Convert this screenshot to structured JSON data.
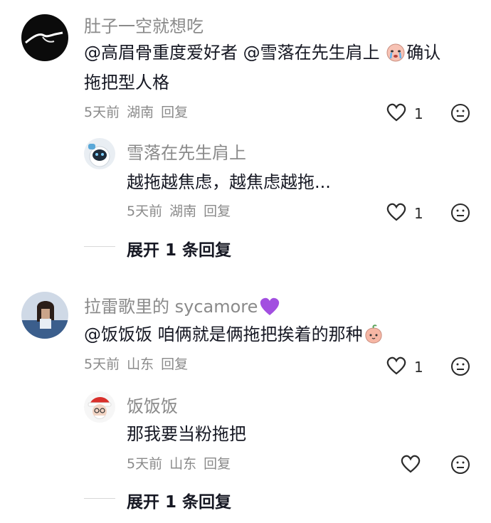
{
  "comments": [
    {
      "username": "肚子一空就想吃",
      "mentions": [
        "@高眉骨重度爱好者",
        "@雪落在先生肩上"
      ],
      "text_after_emoji": "确认",
      "text_line2": "拖把型人格",
      "time": "5天前",
      "location": "湖南",
      "reply_label": "回复",
      "likes": "1",
      "reply": {
        "username": "雪落在先生肩上",
        "text": "越拖越焦虑，越焦虑越拖...",
        "time": "5天前",
        "location": "湖南",
        "reply_label": "回复",
        "likes": "1"
      },
      "expand_label": "展开 1 条回复"
    },
    {
      "username": "拉雷歌里的 sycamore",
      "mention": "@饭饭饭",
      "text": "咱俩就是俩拖把挨着的那种",
      "time": "5天前",
      "location": "山东",
      "reply_label": "回复",
      "likes": "1",
      "reply": {
        "username": "饭饭饭",
        "text": "那我要当粉拖把",
        "time": "5天前",
        "location": "山东",
        "reply_label": "回复",
        "likes": ""
      },
      "expand_label": "展开 1 条回复"
    }
  ],
  "icons": {
    "like": "heart-outline-icon",
    "dislike": "meh-face-icon",
    "emoji_cry": "crying-face-emoji",
    "emoji_peach": "peach-emoji",
    "emoji_heart": "purple-heart-emoji"
  },
  "colors": {
    "text_primary": "#161823",
    "text_secondary": "#8a8a8a",
    "purple_heart": "#a24fe0"
  }
}
